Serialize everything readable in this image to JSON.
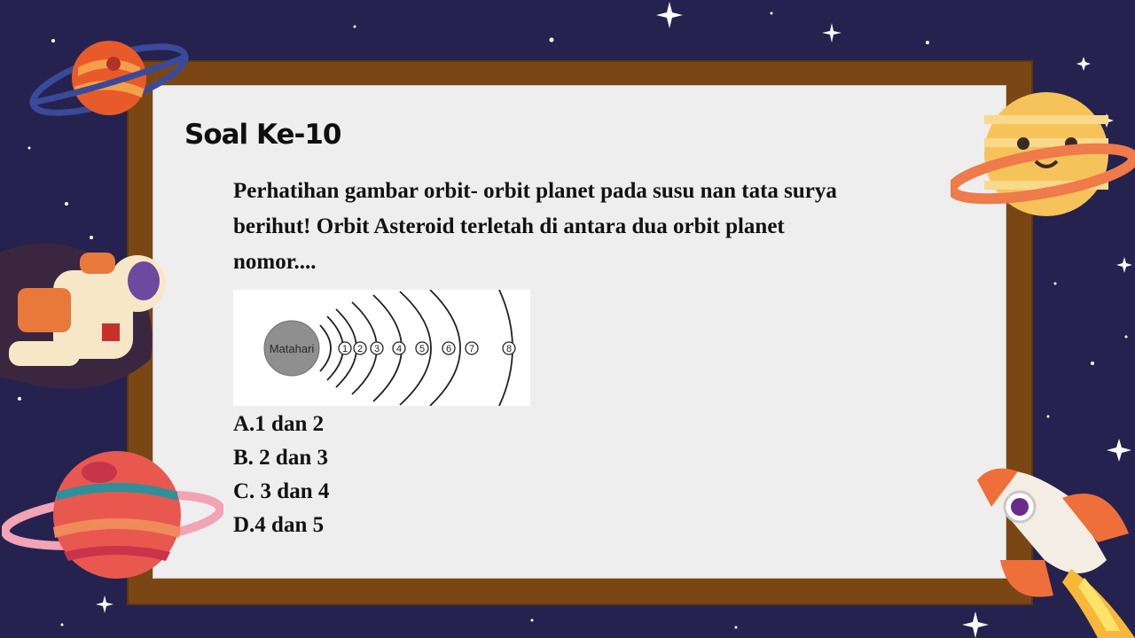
{
  "slide": {
    "title": "Soal Ke-10",
    "question": "Perhatihan gambar orbit- orbit planet pada susu nan tata surya berihut! Orbit Asteroid terletah di antara dua orbit planet nomor....",
    "diagram": {
      "sun_label": "Matahari",
      "orbit_numbers": [
        "1",
        "2",
        "3",
        "4",
        "5",
        "6",
        "7",
        "8"
      ]
    },
    "options": [
      {
        "label": "A.1 dan 2"
      },
      {
        "label": "B. 2 dan 3"
      },
      {
        "label": "C. 3 dan 4"
      },
      {
        "label": "D.4 dan 5"
      }
    ]
  },
  "colors": {
    "background": "#26224f",
    "frame": "#7a4714",
    "board": "#eeeeef",
    "text": "#121212"
  },
  "decorations": [
    "ringed-planet-icon",
    "smiling-planet-icon",
    "astronaut-icon",
    "striped-planet-icon",
    "rocket-icon",
    "star-icon"
  ]
}
